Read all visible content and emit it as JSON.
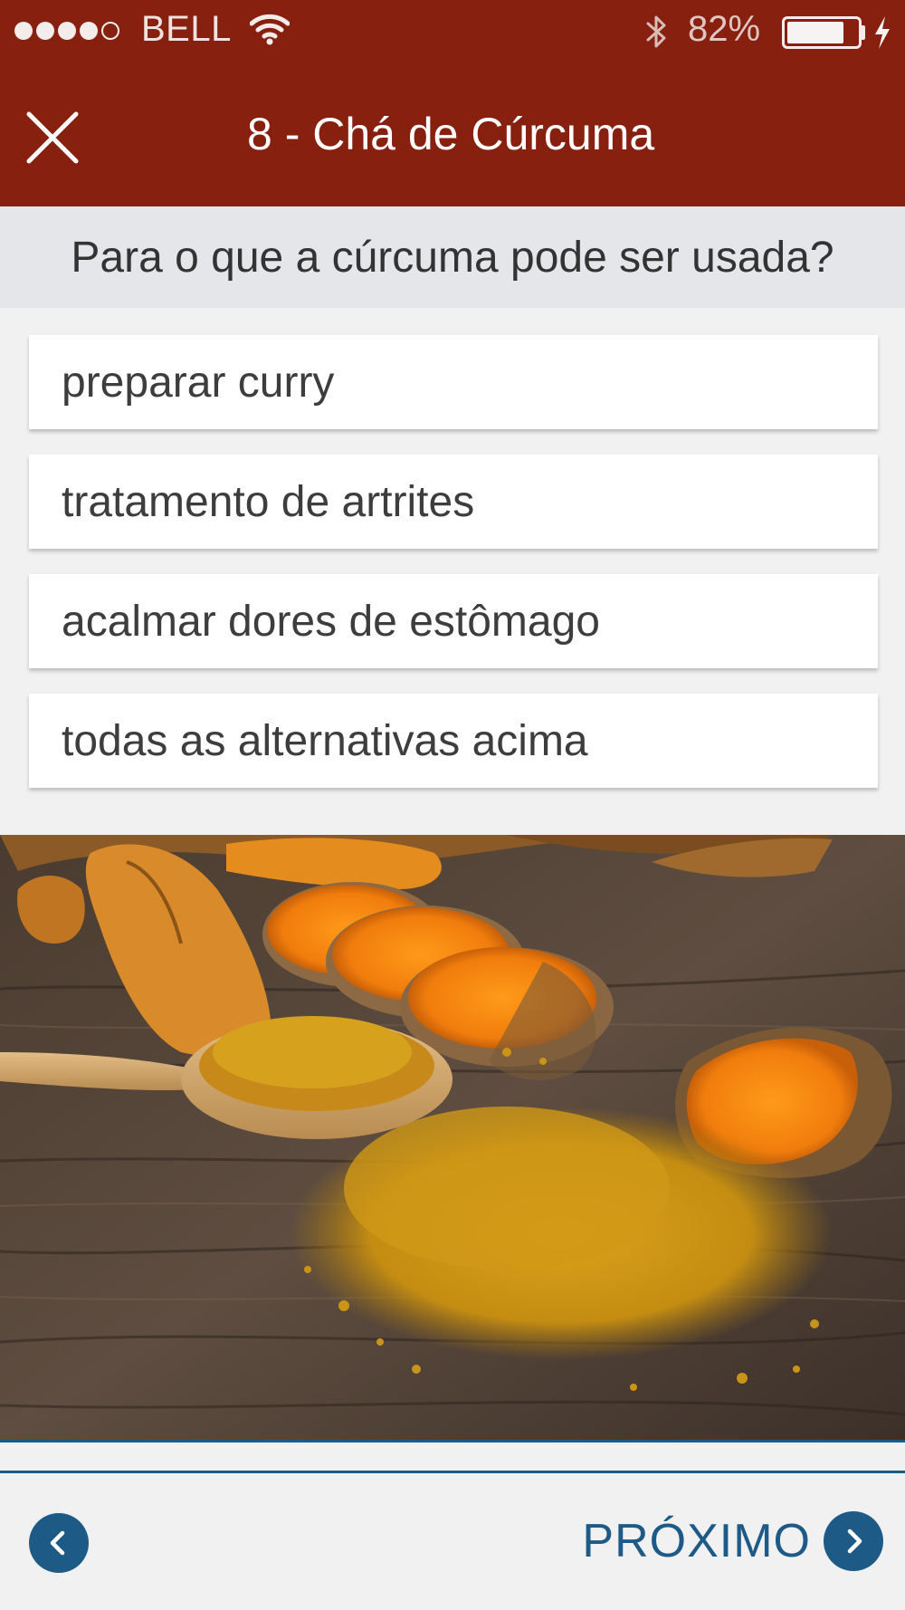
{
  "status_bar": {
    "carrier": "BELL",
    "signal_bars_filled": 4,
    "signal_bars_total": 5,
    "battery_percent": "82%",
    "battery_level": 0.82,
    "icons": [
      "wifi-icon",
      "bluetooth-icon",
      "battery-icon",
      "charging-bolt-icon"
    ]
  },
  "header": {
    "title": "8 - Chá de Cúrcuma",
    "close_icon": "close-icon"
  },
  "question": {
    "text": "Para o que a cúrcuma pode ser usada?"
  },
  "answers": [
    {
      "label": "preparar curry"
    },
    {
      "label": "tratamento de artrites"
    },
    {
      "label": "acalmar dores de estômago"
    },
    {
      "label": "todas as alternativas acima"
    }
  ],
  "footer": {
    "back_icon": "chevron-left-icon",
    "next_label": "PRÓXIMO",
    "next_icon": "chevron-right-icon"
  },
  "colors": {
    "header": "#87200f",
    "accent": "#1d5a86",
    "question_bg": "#e4e6e9",
    "page_bg": "#f1f1f1"
  }
}
